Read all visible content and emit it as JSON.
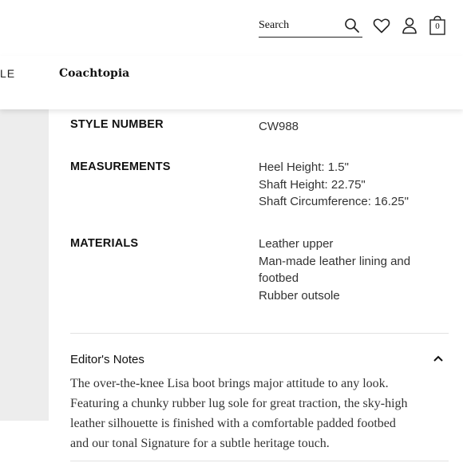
{
  "header": {
    "search_placeholder": "Search",
    "bag_count": "0"
  },
  "nav": {
    "partial_item": "LE",
    "coachtopia": "Coachtopia"
  },
  "specs": [
    {
      "label": "STYLE NUMBER",
      "values": [
        "CW988"
      ]
    },
    {
      "label": "MEASUREMENTS",
      "values": [
        "Heel Height: 1.5\"",
        "Shaft Height: 22.75\"",
        "Shaft Circumference: 16.25\""
      ]
    },
    {
      "label": "MATERIALS",
      "values": [
        "Leather upper",
        "Man-made leather lining and",
        "footbed",
        "Rubber outsole"
      ]
    }
  ],
  "editors_notes": {
    "heading": "Editor's Notes",
    "lines": [
      "The over-the-knee Lisa boot brings major attitude to any look.",
      "Featuring a chunky rubber lug sole for great traction, the sky-high",
      "leather silhouette is finished with a comfortable padded footbed",
      "and our tonal Signature for a subtle heritage touch."
    ]
  }
}
